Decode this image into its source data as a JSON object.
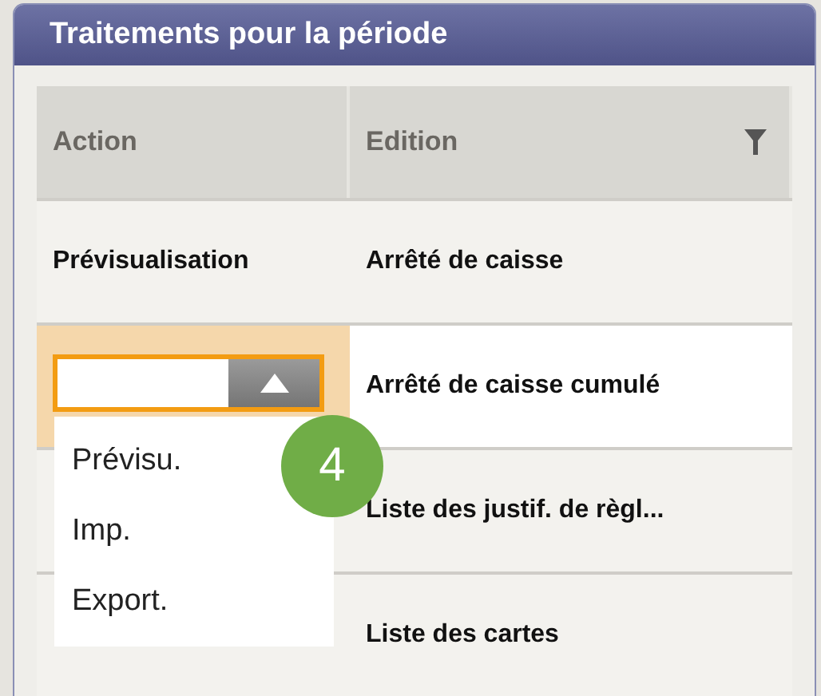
{
  "panel": {
    "title": "Traitements pour la période"
  },
  "columns": [
    {
      "label": "Action",
      "filter": false
    },
    {
      "label": "Edition",
      "filter": true
    }
  ],
  "rows": [
    {
      "action": "Prévisualisation",
      "edition": "Arrêté de caisse",
      "selected": false
    },
    {
      "edition": "Arrêté de caisse cumulé",
      "selected": true,
      "dropdown": {
        "expanded": true,
        "options": [
          "Prévisu.",
          "Imp.",
          "Export."
        ]
      }
    },
    {
      "edition": "Liste des justif. de règl...",
      "selected": false
    },
    {
      "edition": "Liste des cartes",
      "selected": false
    }
  ],
  "step_badge": "4"
}
